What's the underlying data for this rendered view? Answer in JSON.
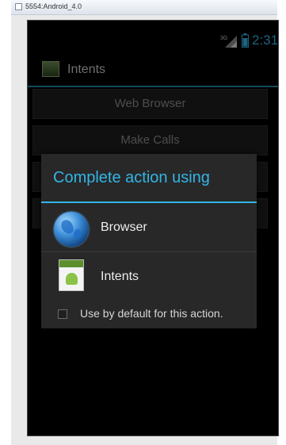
{
  "window": {
    "title": "5554:Android_4.0"
  },
  "status_bar": {
    "network_type": "3G",
    "time": "2:31"
  },
  "action_bar": {
    "app_title": "Intents"
  },
  "main": {
    "buttons": [
      {
        "label": "Web Browser"
      },
      {
        "label": "Make Calls"
      },
      {
        "label": ""
      },
      {
        "label": ""
      }
    ]
  },
  "chooser_dialog": {
    "title": "Complete action using",
    "apps": [
      {
        "label": "Browser",
        "icon": "browser-globe-icon"
      },
      {
        "label": "Intents",
        "icon": "intents-app-icon"
      }
    ],
    "default_checkbox_label": "Use by default for this action.",
    "default_checked": false
  },
  "colors": {
    "accent": "#33b5e5",
    "dialog_bg": "#282828",
    "screen_bg": "#000000"
  }
}
